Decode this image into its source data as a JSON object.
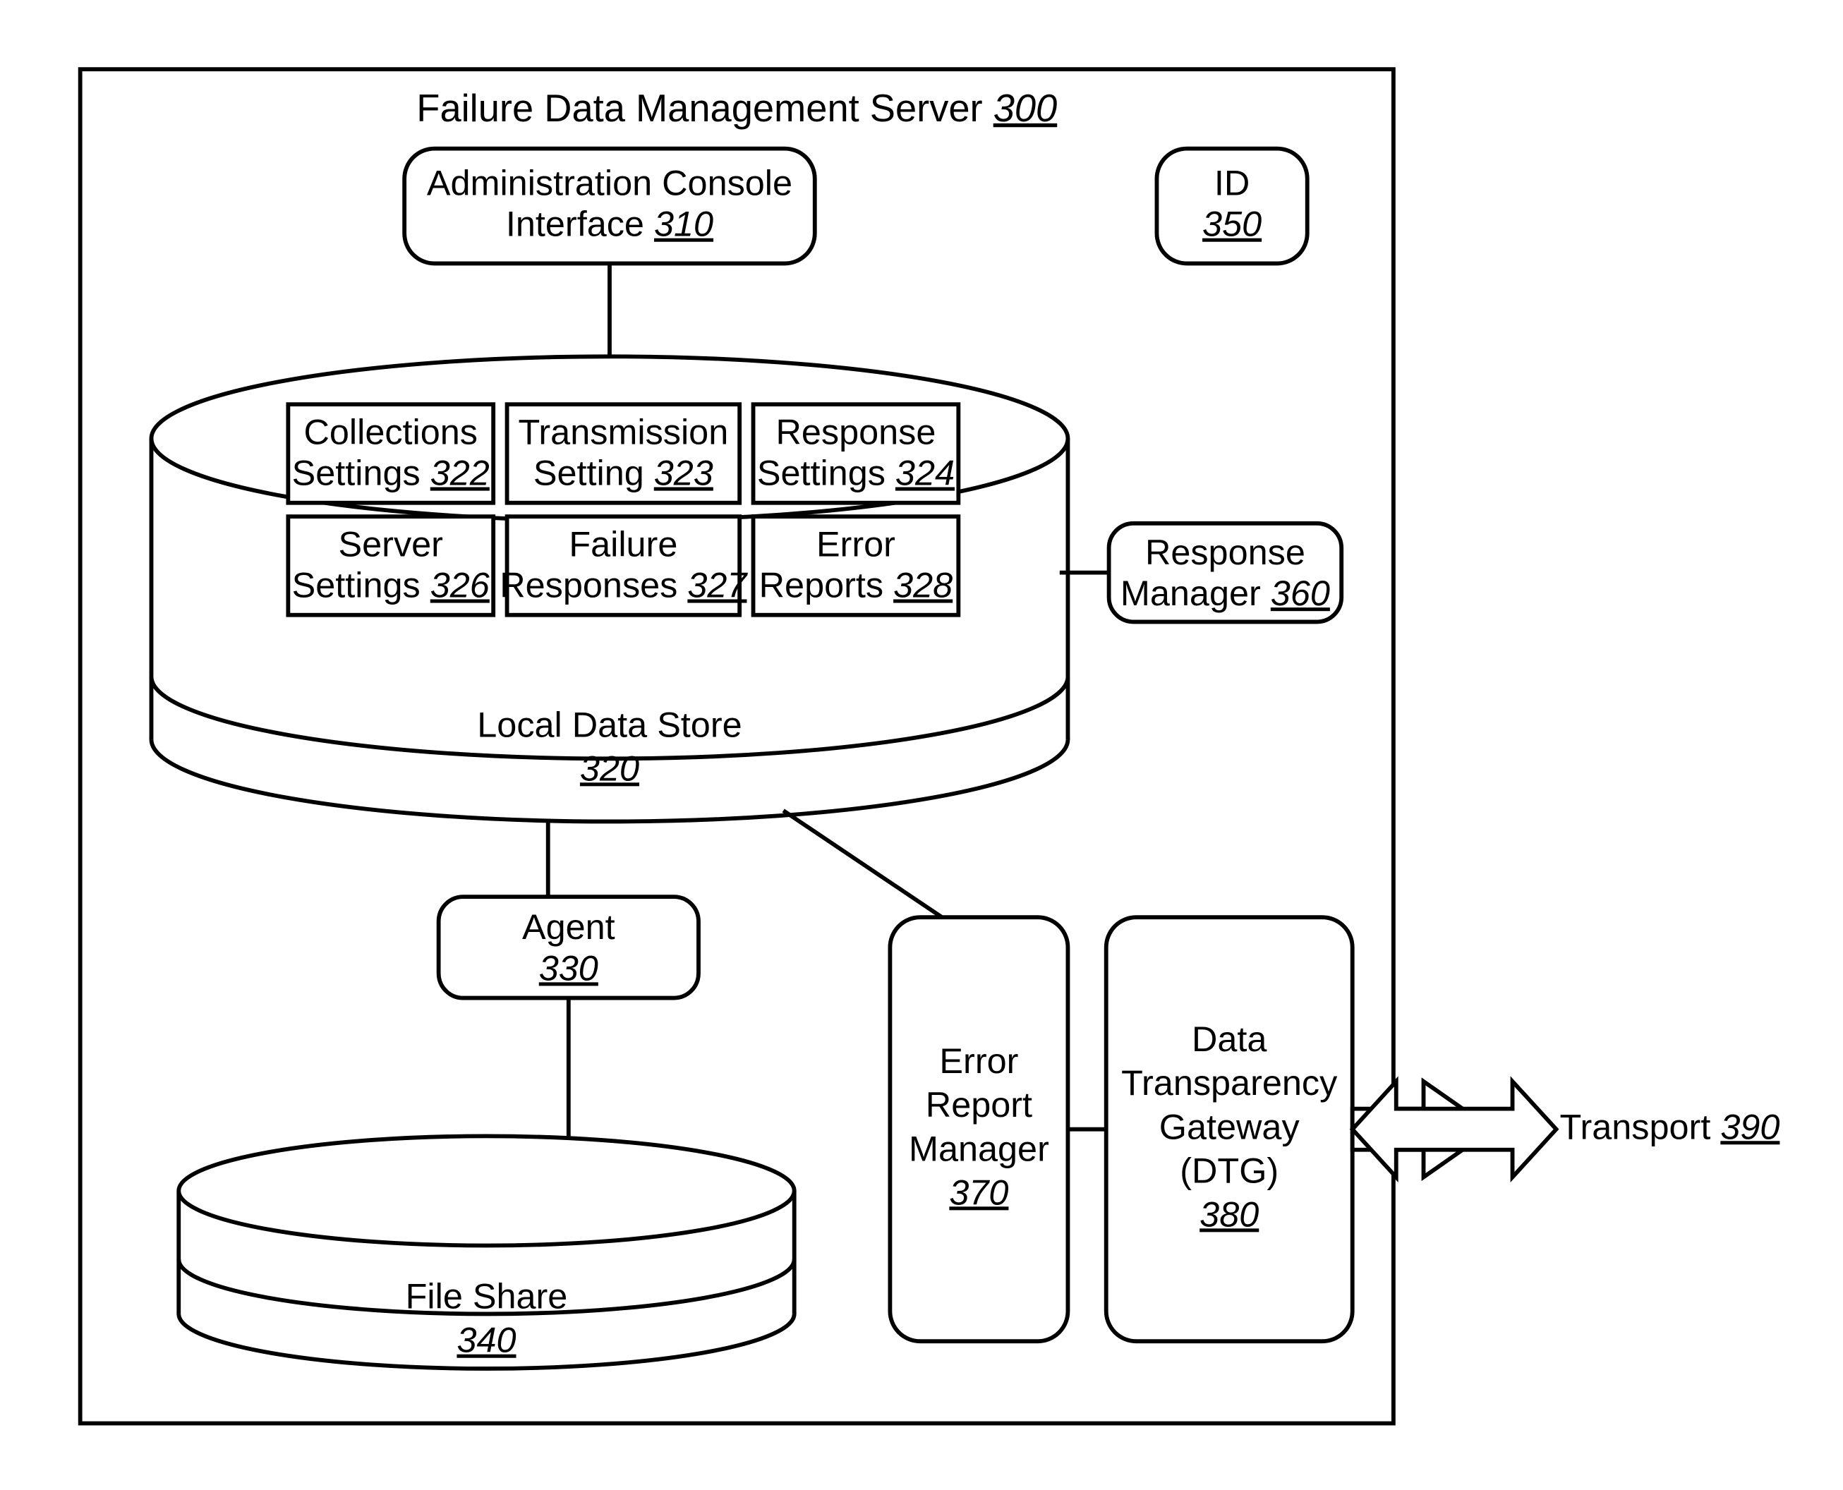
{
  "title": {
    "label": "Failure Data Management Server",
    "ref": "300"
  },
  "admin": {
    "line1": "Administration Console",
    "line2": "Interface",
    "ref": "310"
  },
  "id": {
    "label": "ID",
    "ref": "350"
  },
  "datastore": {
    "label": "Local Data Store",
    "ref": "320"
  },
  "cells": {
    "c1": {
      "line1": "Collections",
      "line2_pre": "Settings ",
      "ref": "322"
    },
    "c2": {
      "line1": "Transmission",
      "line2_pre": "Setting ",
      "ref": "323"
    },
    "c3": {
      "line1": "Response",
      "line2_pre": "Settings ",
      "ref": "324"
    },
    "c4": {
      "line1": "Server",
      "line2_pre": "Settings ",
      "ref": "326"
    },
    "c5": {
      "line1": "Failure",
      "line2_pre": "Responses ",
      "ref": "327"
    },
    "c6": {
      "line1": "Error",
      "line2_pre": "Reports ",
      "ref": "328"
    }
  },
  "agent": {
    "label": "Agent",
    "ref": "330"
  },
  "fileshare": {
    "label": "File Share",
    "ref": "340"
  },
  "respmgr": {
    "line1": "Response",
    "line2_pre": "Manager ",
    "ref": "360"
  },
  "errmgr": {
    "line1": "Error",
    "line2": "Report",
    "line3": "Manager",
    "ref": "370"
  },
  "dtg": {
    "line1": "Data",
    "line2": "Transparency",
    "line3": "Gateway",
    "line4": "(DTG)",
    "ref": "380"
  },
  "transport": {
    "label_pre": "Transport ",
    "ref": "390"
  }
}
